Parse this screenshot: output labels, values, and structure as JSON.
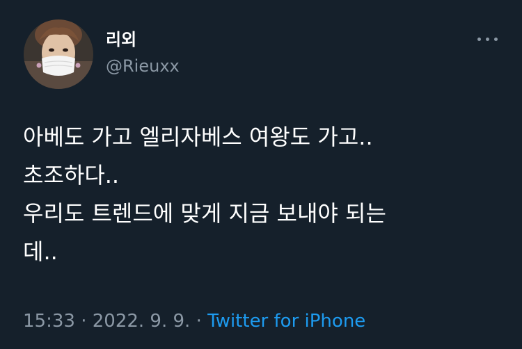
{
  "author": {
    "display_name": "리외",
    "handle": "@Rieuxx"
  },
  "tweet": {
    "lines": [
      "아베도 가고 엘리자베스 여왕도 가고..",
      "초조하다..",
      "우리도 트렌드에 맞게 지금 보내야 되는",
      "데.."
    ]
  },
  "meta": {
    "time": "15:33",
    "separator": " · ",
    "date": "2022. 9. 9.",
    "source": "Twitter for iPhone"
  },
  "icons": {
    "more": "more-horizontal-icon"
  },
  "colors": {
    "background": "#15202b",
    "text_primary": "#ffffff",
    "text_secondary": "#8b98a5",
    "link": "#1d9bf0"
  }
}
